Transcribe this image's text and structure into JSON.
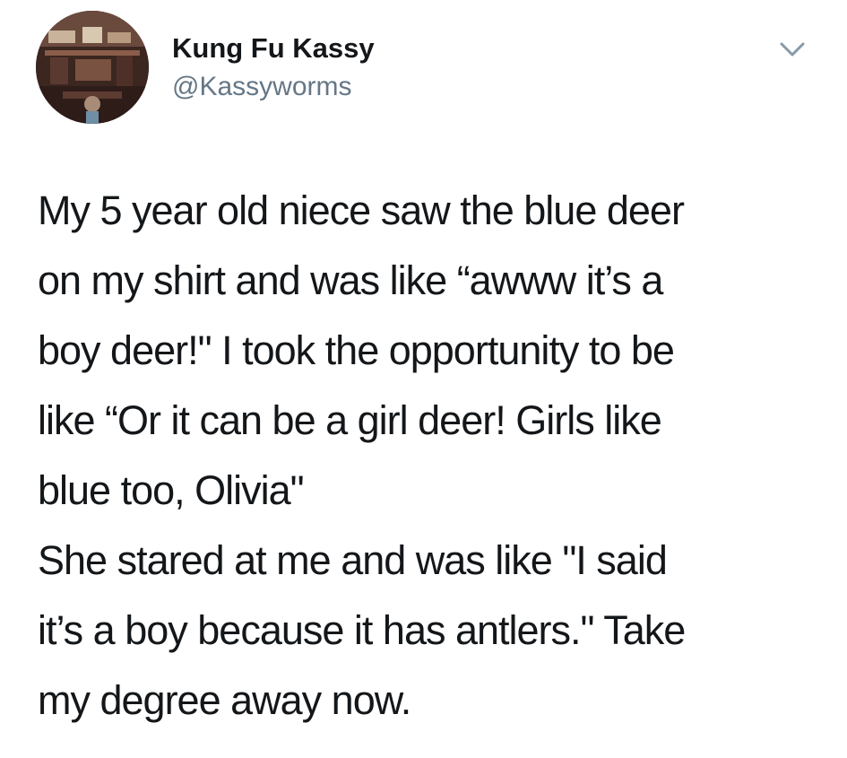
{
  "author": {
    "display_name": "Kung Fu Kassy",
    "handle": "@Kassyworms",
    "avatar_icon": "profile-photo"
  },
  "menu": {
    "icon": "chevron-down-icon"
  },
  "tweet": {
    "lines": [
      "My 5 year old niece saw the blue deer",
      "on my shirt and was like “awww it’s a",
      "boy deer!\" I took the opportunity to be",
      "like “Or it can be a girl deer! Girls like",
      "blue too, Olivia\"",
      "She stared at me and was like \"I said",
      "it’s a boy because it has antlers.\" Take",
      "my degree away now."
    ]
  },
  "colors": {
    "text": "#14171a",
    "secondary_text": "#657786",
    "background": "#ffffff"
  }
}
